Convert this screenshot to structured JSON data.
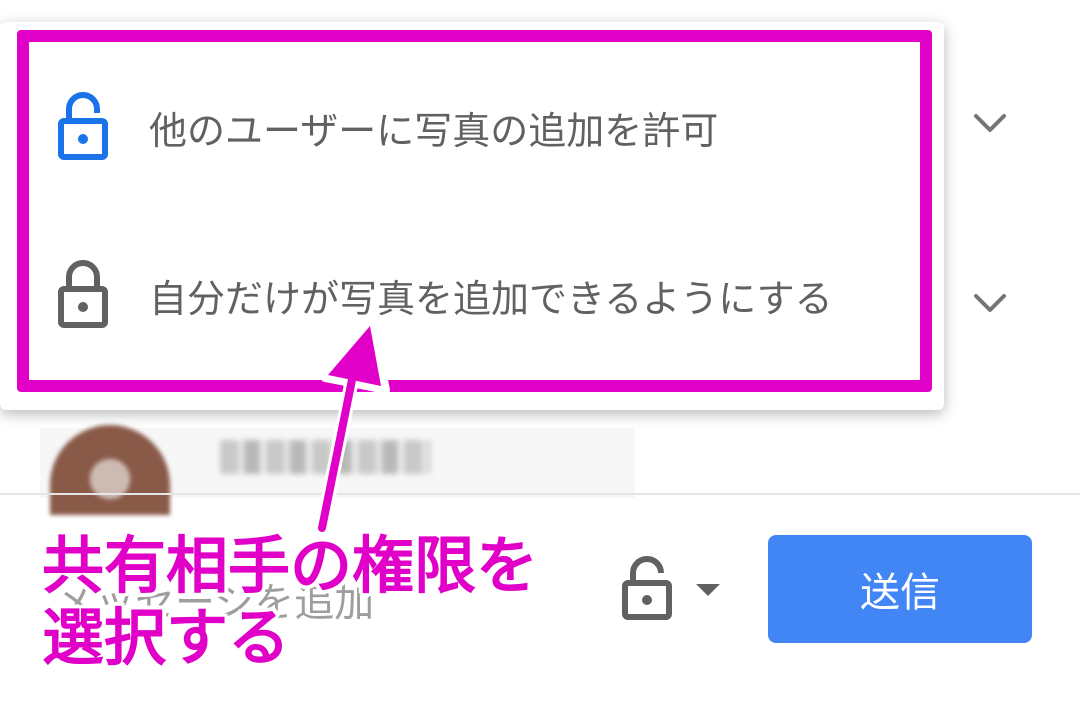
{
  "menu": {
    "items": [
      {
        "label": "他のユーザーに写真の追加を許可",
        "icon": "lock-open-icon",
        "icon_color": "#1a73e8"
      },
      {
        "label": "自分だけが写真を追加できるようにする",
        "icon": "lock-closed-icon",
        "icon_color": "#616161"
      }
    ]
  },
  "footer": {
    "comment_placeholder": "メッセージを追加",
    "send_label": "送信",
    "lock_icon": "lock-open-icon",
    "dropdown_icon": "caret-down-icon"
  },
  "annotation": {
    "lines": [
      "共有相手の権限を",
      "選択する"
    ],
    "color": "#e000c8"
  },
  "colors": {
    "accent": "#4285f4",
    "highlight": "#e000c8",
    "text": "#616161"
  }
}
